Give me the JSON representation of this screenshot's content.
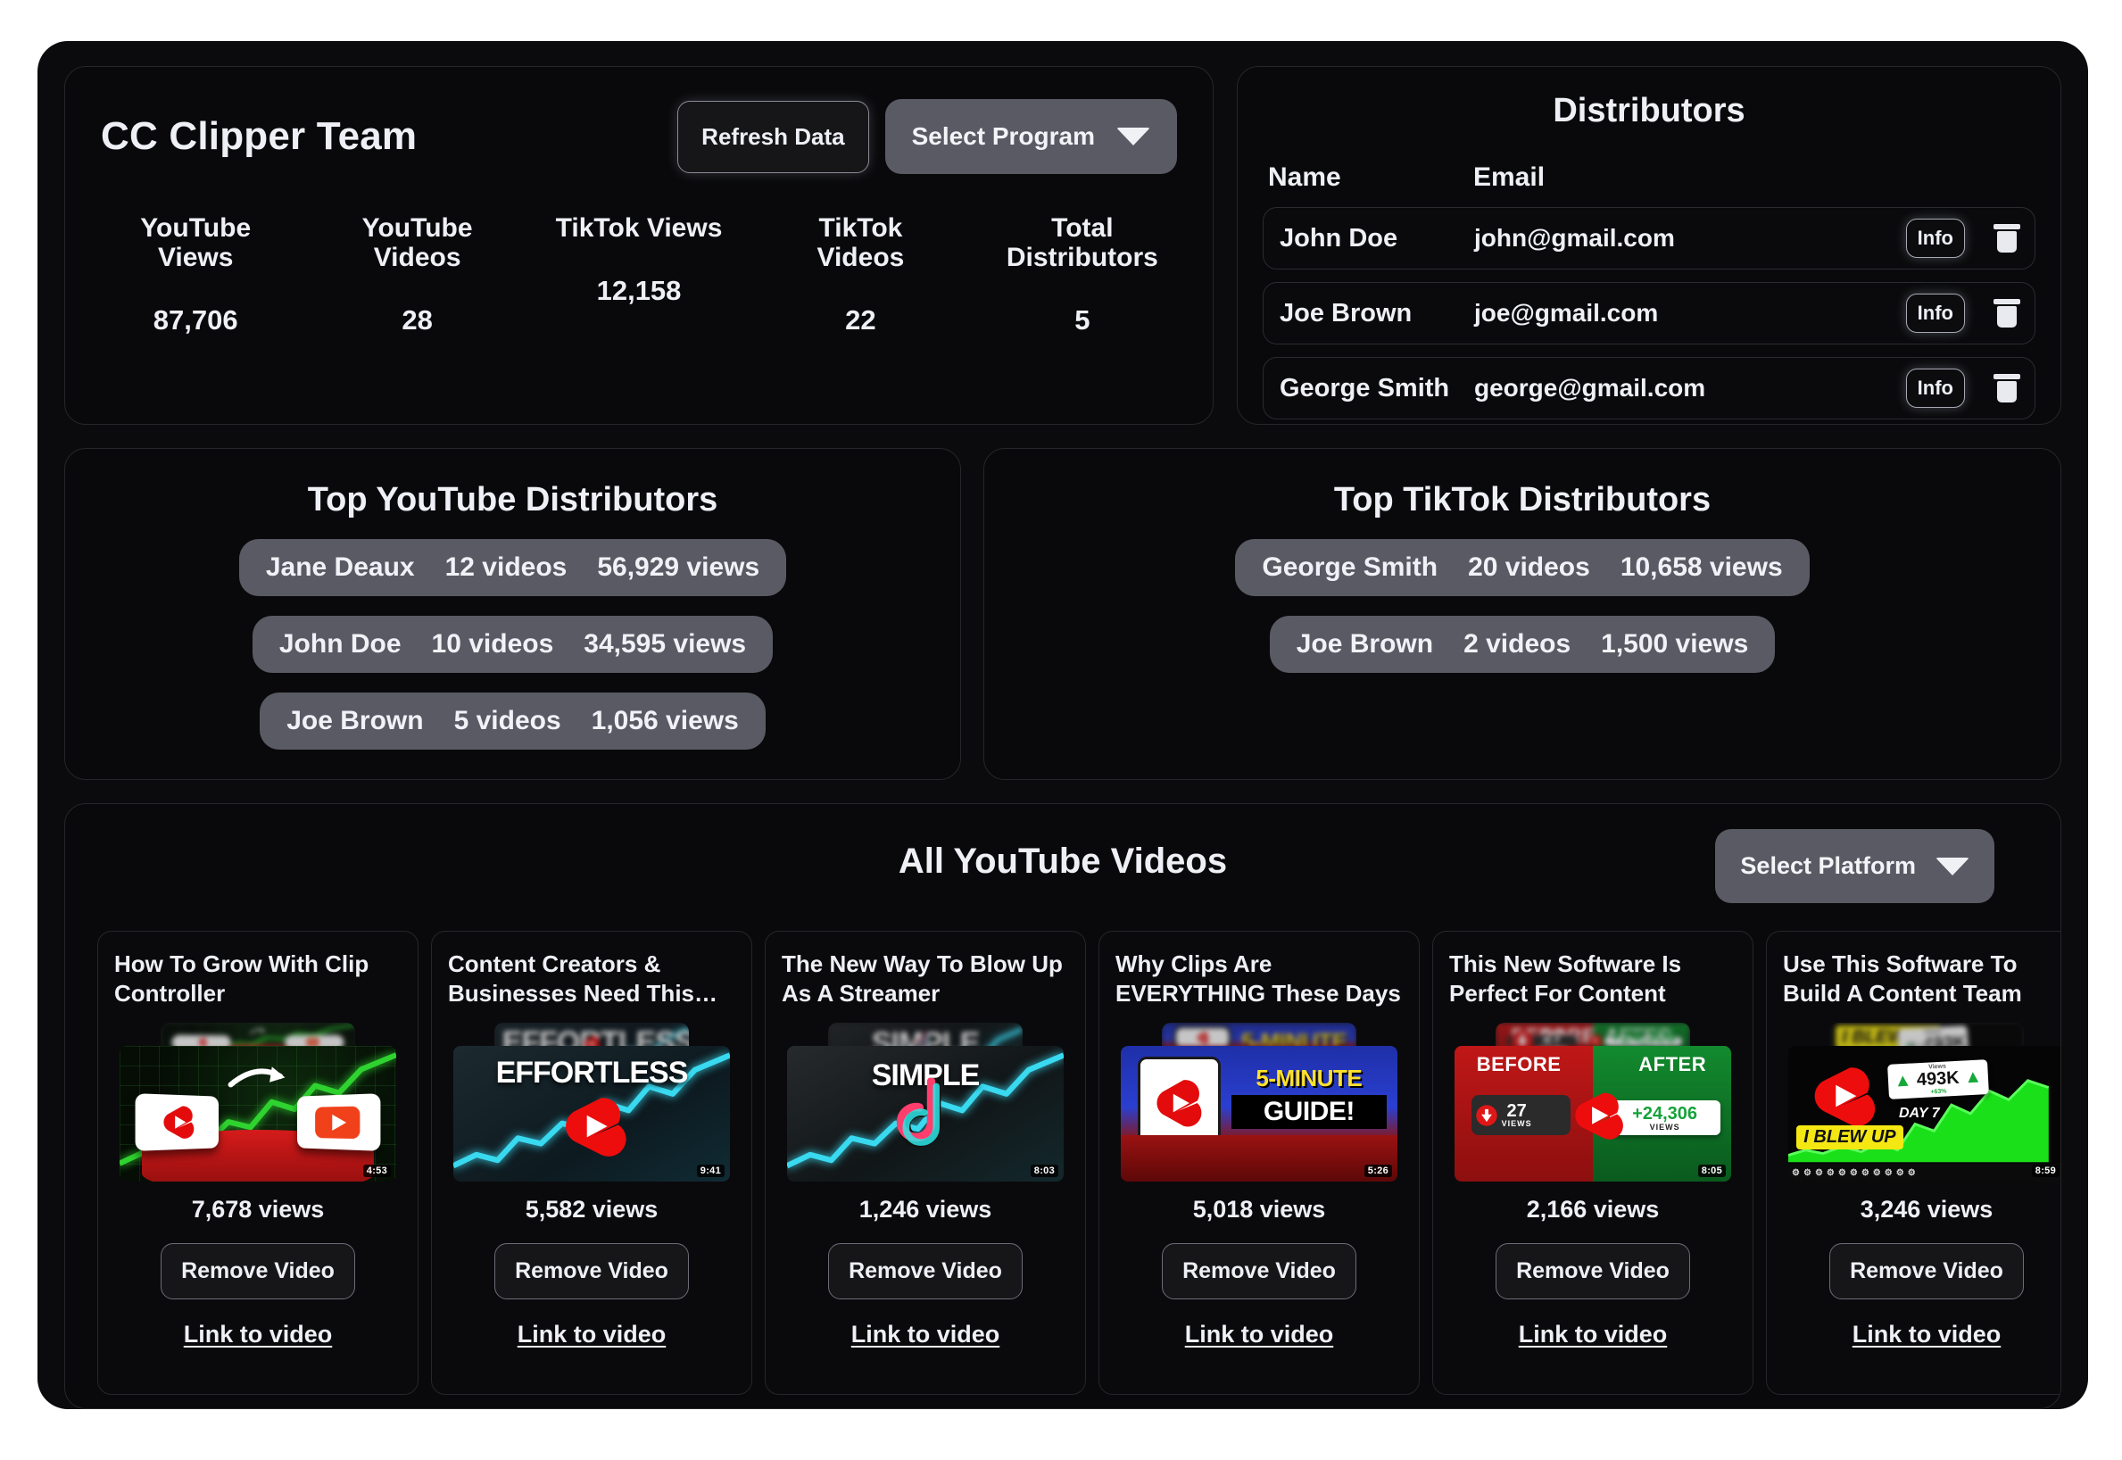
{
  "team": {
    "title": "CC Clipper Team",
    "refresh_label": "Refresh Data",
    "select_program_label": "Select Program",
    "stats": [
      {
        "label": "YouTube Views",
        "value": "87,706"
      },
      {
        "label": "YouTube Videos",
        "value": "28"
      },
      {
        "label": "TikTok Views",
        "value": "12,158"
      },
      {
        "label": "TikTok Videos",
        "value": "22"
      },
      {
        "label": "Total Distributors",
        "value": "5"
      }
    ]
  },
  "distributors": {
    "title": "Distributors",
    "col_name": "Name",
    "col_email": "Email",
    "info_label": "Info",
    "rows": [
      {
        "name": "John Doe",
        "email": "john@gmail.com"
      },
      {
        "name": "Joe Brown",
        "email": "joe@gmail.com"
      },
      {
        "name": "George Smith",
        "email": "george@gmail.com"
      }
    ]
  },
  "top_youtube": {
    "title": "Top YouTube Distributors",
    "rows": [
      {
        "name": "Jane Deaux",
        "videos": "12 videos",
        "views": "56,929 views"
      },
      {
        "name": "John Doe",
        "videos": "10 videos",
        "views": "34,595 views"
      },
      {
        "name": "Joe Brown",
        "videos": "5 videos",
        "views": "1,056 views"
      }
    ]
  },
  "top_tiktok": {
    "title": "Top TikTok Distributors",
    "rows": [
      {
        "name": "George Smith",
        "videos": "20 videos",
        "views": "10,658 views"
      },
      {
        "name": "Joe Brown",
        "videos": "2 videos",
        "views": "1,500 views"
      }
    ]
  },
  "videos": {
    "title": "All YouTube Videos",
    "select_platform_label": "Select Platform",
    "remove_label": "Remove Video",
    "link_label": "Link to video",
    "items": [
      {
        "title": "How To Grow With Clip Controller",
        "views": "7,678 views",
        "duration": "4:53"
      },
      {
        "title": "Content Creators & Businesses Need This…",
        "views": "5,582 views",
        "duration": "9:41"
      },
      {
        "title": "The New Way To Blow Up As A Streamer",
        "views": "1,246 views",
        "duration": "8:03"
      },
      {
        "title": "Why Clips Are EVERYTHING These Days",
        "views": "5,018 views",
        "duration": "5:26"
      },
      {
        "title": "This New Software Is Perfect For Content Creators",
        "views": "2,166 views",
        "duration": "8:05"
      },
      {
        "title": "Use This Software To Build A Content Team",
        "views": "3,246 views",
        "duration": "8:59"
      }
    ],
    "thumb_text": {
      "t2_word": "EFFORTLESS",
      "t3_word": "SIMPLE",
      "t4_line1": "5-MINUTE",
      "t4_line2": "GUIDE!",
      "t5_before": "BEFORE",
      "t5_after": "AFTER",
      "t5_before_num": "27",
      "t5_before_sub": "VIEWS",
      "t5_after_num": "+24,306",
      "t5_after_sub": "VIEWS",
      "t6_blew": "I BLEW UP",
      "t6_views_cap": "Views",
      "t6_views_num": "493K",
      "t6_views_pct": "+63%",
      "t6_day": "DAY 7"
    }
  },
  "colors": {
    "page_bg": "#ffffff",
    "shell_bg": "#0b0b0d",
    "panel_bg": "#09090b",
    "panel_border": "#26262b",
    "text": "#eef0f6",
    "accent_gray": "#5a5a64"
  }
}
